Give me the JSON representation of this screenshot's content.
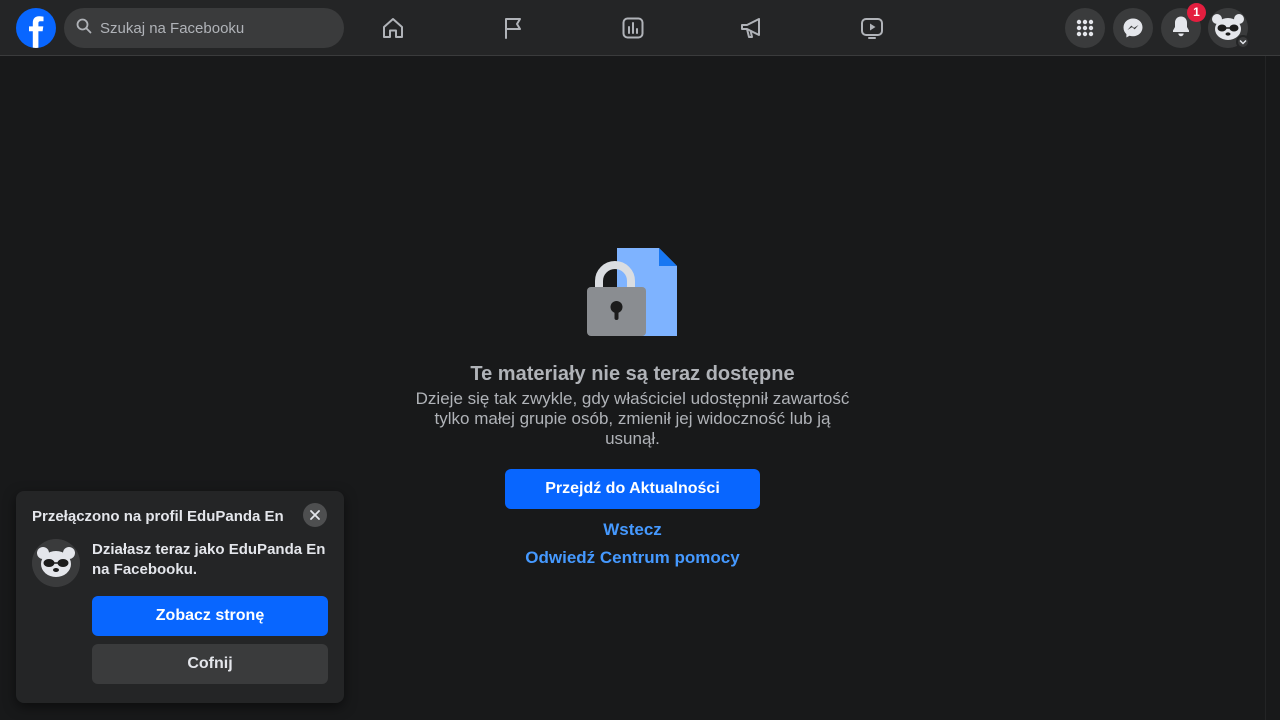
{
  "colors": {
    "background": "#18191a",
    "topbar": "#242526",
    "accent": "#0866ff",
    "link": "#4599ff",
    "badge": "#e41e3f"
  },
  "topbar": {
    "logo_icon": "facebook-logo-icon",
    "search": {
      "placeholder": "Szukaj na Facebooku",
      "icon": "search-icon"
    },
    "nav_icons": [
      "home-icon",
      "flag-icon",
      "chart-icon",
      "megaphone-icon",
      "video-icon"
    ],
    "menu_icon": "grid-menu-icon",
    "messenger_icon": "messenger-icon",
    "notifications": {
      "icon": "bell-icon",
      "count": "1"
    },
    "profile_icon": "panda-avatar"
  },
  "main": {
    "icon": "lock-document-icon",
    "title": "Te materiały nie są teraz dostępne",
    "description": "Dzieje się tak zwykle, gdy właściciel udostępnił zawartość tylko małej grupie osób, zmienił jej widoczność lub ją usunął.",
    "primary_button": "Przejdź do Aktualności",
    "back_link": "Wstecz",
    "help_link": "Odwiedź Centrum pomocy"
  },
  "toast": {
    "title": "Przełączono na profil EduPanda En",
    "message": "Działasz teraz jako EduPanda En na Facebooku.",
    "primary_button": "Zobacz stronę",
    "secondary_button": "Cofnij"
  }
}
